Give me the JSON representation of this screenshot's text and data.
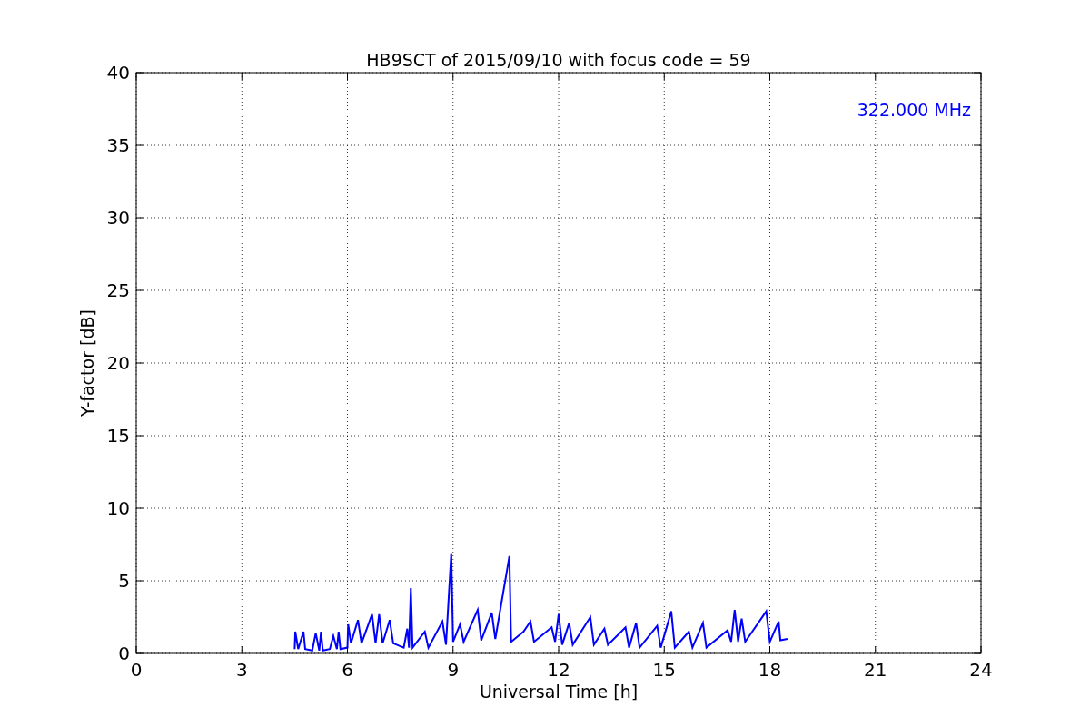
{
  "chart_data": {
    "type": "line",
    "title": "HB9SCT of 2015/09/10 with focus code = 59",
    "xlabel": "Universal Time [h]",
    "ylabel": "Y-factor [dB]",
    "xlim": [
      0,
      24
    ],
    "ylim": [
      0,
      40
    ],
    "xticks": [
      0,
      3,
      6,
      9,
      12,
      15,
      18,
      21,
      24
    ],
    "yticks": [
      0,
      5,
      10,
      15,
      20,
      25,
      30,
      35,
      40
    ],
    "grid": true,
    "x": [
      4.5,
      4.52,
      4.6,
      4.75,
      4.8,
      5.0,
      5.1,
      5.2,
      5.25,
      5.3,
      5.5,
      5.6,
      5.7,
      5.75,
      5.8,
      6.0,
      6.02,
      6.1,
      6.3,
      6.4,
      6.7,
      6.8,
      6.9,
      7.0,
      7.2,
      7.3,
      7.6,
      7.7,
      7.75,
      7.8,
      7.85,
      8.2,
      8.3,
      8.7,
      8.8,
      8.95,
      9.0,
      9.2,
      9.3,
      9.7,
      9.8,
      10.1,
      10.2,
      10.6,
      10.65,
      11.0,
      11.2,
      11.3,
      11.8,
      11.9,
      12.0,
      12.1,
      12.3,
      12.4,
      12.9,
      13.0,
      13.3,
      13.4,
      13.9,
      14.0,
      14.2,
      14.3,
      14.8,
      14.9,
      15.2,
      15.3,
      15.7,
      15.8,
      16.1,
      16.2,
      16.8,
      16.9,
      17.0,
      17.1,
      17.2,
      17.3,
      17.9,
      18.0,
      18.25,
      18.3,
      18.5
    ],
    "series": [
      {
        "name": "322.000 MHz",
        "color": "#0000ff",
        "values": [
          0.3,
          1.5,
          0.3,
          1.5,
          0.3,
          0.2,
          1.4,
          0.2,
          1.5,
          0.2,
          0.3,
          1.2,
          0.3,
          1.5,
          0.3,
          0.4,
          2.0,
          0.7,
          2.3,
          0.7,
          2.7,
          0.7,
          2.7,
          0.7,
          2.3,
          0.7,
          0.4,
          1.7,
          0.4,
          4.5,
          0.4,
          1.5,
          0.4,
          2.2,
          0.6,
          6.9,
          0.8,
          2.0,
          0.8,
          3.0,
          0.9,
          2.8,
          1.0,
          6.7,
          0.8,
          1.5,
          2.2,
          0.8,
          1.8,
          0.8,
          2.7,
          0.6,
          2.1,
          0.6,
          2.5,
          0.6,
          1.7,
          0.6,
          1.8,
          0.4,
          2.1,
          0.4,
          1.9,
          0.4,
          2.9,
          0.4,
          1.5,
          0.4,
          2.1,
          0.4,
          1.6,
          0.8,
          3.0,
          0.8,
          2.4,
          0.8,
          2.9,
          0.8,
          2.2,
          0.9,
          1.0
        ]
      }
    ]
  }
}
